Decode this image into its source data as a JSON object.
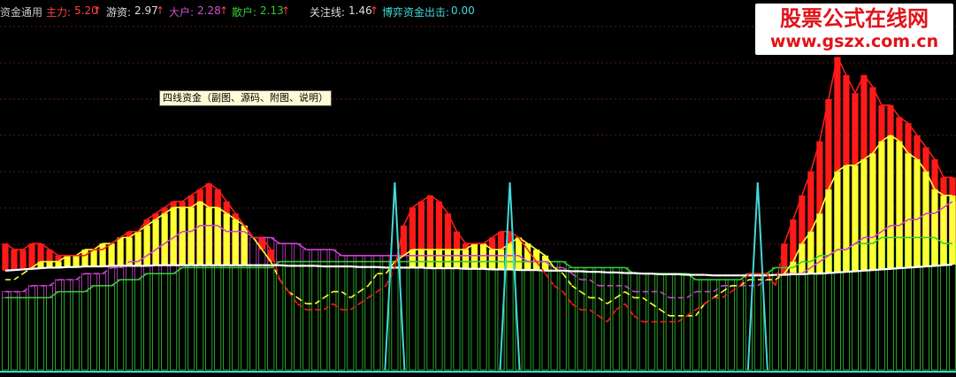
{
  "legend": {
    "indicator_name": "资金通用",
    "main_label": "主力:",
    "main_value": "5.20",
    "hot_label": "游资:",
    "hot_value": "2.97",
    "big_label": "大户:",
    "big_value": "2.28",
    "retail_label": "散户:",
    "retail_value": "2.13",
    "focus_label": "关注线:",
    "focus_value": "1.46",
    "outflow_label": "博弈资金出击:",
    "outflow_value": "0.00",
    "up_arrow": "↑"
  },
  "annotation": {
    "text": "四线资金（副图、源码、附图、说明）"
  },
  "watermark": {
    "line1": "股票公式在线网",
    "line2": "www.gszx.com.cn"
  },
  "colors": {
    "background": "#000000",
    "main": "#ff1a1a",
    "hot": "#ffff33",
    "big": "#cc44cc",
    "retail": "#33cc33",
    "focus": "#ffffff",
    "outflow": "#44d8d8",
    "grid": "#5a1a1a",
    "legend_text": "#c8c8c8"
  },
  "chart_data": {
    "type": "line",
    "title": "四线资金（副图、源码、附图、说明）",
    "grid": true,
    "x": [
      1,
      2,
      3,
      4,
      5,
      6,
      7,
      8,
      9,
      10,
      11,
      12,
      13,
      14,
      15,
      16,
      17,
      18,
      19,
      20,
      21,
      22,
      23,
      24,
      25,
      26,
      27,
      28,
      29,
      30,
      31,
      32,
      33,
      34,
      35,
      36,
      37,
      38,
      39,
      40,
      41,
      42,
      43,
      44,
      45,
      46,
      47,
      48,
      49,
      50,
      51,
      52,
      53,
      54,
      55,
      56,
      57,
      58,
      59,
      60,
      61,
      62,
      63,
      64,
      65,
      66,
      67,
      68,
      69,
      70,
      71,
      72,
      73,
      74,
      75,
      76,
      77,
      78,
      79,
      80,
      81,
      82,
      83,
      84,
      85,
      86,
      87,
      88,
      89,
      90,
      91,
      92,
      93,
      94,
      95,
      96,
      97,
      98,
      99,
      100,
      101,
      102,
      103,
      104,
      105,
      106,
      107,
      108
    ],
    "ylim": [
      0,
      6
    ],
    "series": [
      {
        "name": "主力",
        "color": "#ff1a1a",
        "style": "solid",
        "values": [
          2.1,
          2.0,
          2.0,
          2.1,
          2.1,
          2.0,
          1.9,
          1.9,
          1.9,
          1.9,
          2.0,
          2.0,
          2.1,
          2.2,
          2.3,
          2.3,
          2.5,
          2.6,
          2.7,
          2.8,
          2.8,
          2.9,
          3.0,
          3.1,
          3.0,
          2.8,
          2.6,
          2.4,
          2.2,
          2.2,
          2.0,
          1.5,
          1.3,
          1.1,
          1.0,
          1.0,
          1.0,
          1.1,
          1.0,
          1.0,
          1.1,
          1.2,
          1.3,
          1.4,
          1.7,
          2.4,
          2.7,
          2.8,
          2.9,
          2.8,
          2.6,
          2.3,
          2.1,
          2.1,
          2.1,
          2.2,
          2.3,
          2.3,
          2.2,
          2.0,
          1.8,
          1.6,
          1.4,
          1.3,
          1.1,
          1.0,
          1.0,
          0.9,
          0.8,
          1.0,
          1.1,
          0.9,
          0.8,
          0.8,
          0.8,
          0.8,
          0.8,
          0.9,
          1.0,
          1.1,
          1.2,
          1.2,
          1.3,
          1.4,
          1.6,
          1.6,
          1.6,
          1.4,
          2.1,
          2.5,
          2.9,
          3.3,
          3.8,
          4.5,
          5.2,
          4.9,
          4.6,
          4.9,
          4.7,
          4.4,
          4.4,
          4.2,
          4.1,
          3.9,
          3.7,
          3.5,
          3.2,
          3.2
        ]
      },
      {
        "name": "游资",
        "color": "#ffff33",
        "style": "solid",
        "values": [
          1.5,
          1.5,
          1.6,
          1.7,
          1.8,
          1.8,
          1.8,
          1.9,
          1.9,
          2.0,
          2.0,
          2.1,
          2.1,
          2.2,
          2.2,
          2.3,
          2.4,
          2.5,
          2.6,
          2.7,
          2.7,
          2.7,
          2.8,
          2.7,
          2.7,
          2.6,
          2.5,
          2.4,
          2.2,
          2.0,
          1.8,
          1.5,
          1.3,
          1.2,
          1.1,
          1.1,
          1.2,
          1.3,
          1.3,
          1.2,
          1.3,
          1.4,
          1.6,
          1.6,
          1.8,
          1.9,
          2.0,
          2.0,
          2.0,
          2.0,
          2.0,
          2.0,
          2.0,
          2.1,
          2.1,
          2.0,
          2.0,
          2.1,
          2.2,
          2.1,
          2.0,
          1.9,
          1.7,
          1.6,
          1.4,
          1.3,
          1.2,
          1.2,
          1.1,
          1.2,
          1.3,
          1.2,
          1.2,
          1.1,
          1.0,
          0.9,
          0.9,
          0.9,
          0.9,
          1.1,
          1.2,
          1.3,
          1.4,
          1.4,
          1.5,
          1.5,
          1.5,
          1.5,
          1.6,
          1.8,
          2.1,
          2.3,
          2.6,
          3.0,
          3.3,
          3.4,
          3.4,
          3.5,
          3.6,
          3.8,
          3.9,
          3.8,
          3.6,
          3.5,
          3.3,
          3.0,
          2.9,
          2.9
        ]
      },
      {
        "name": "大户",
        "color": "#cc44cc",
        "style": "solid",
        "values": [
          1.3,
          1.3,
          1.3,
          1.4,
          1.4,
          1.4,
          1.5,
          1.5,
          1.5,
          1.6,
          1.6,
          1.6,
          1.7,
          1.7,
          1.8,
          1.8,
          1.9,
          2.0,
          2.1,
          2.2,
          2.3,
          2.3,
          2.4,
          2.4,
          2.4,
          2.3,
          2.3,
          2.3,
          2.2,
          2.2,
          2.2,
          2.1,
          2.1,
          2.1,
          2.0,
          2.0,
          2.0,
          2.0,
          1.9,
          1.9,
          1.9,
          1.9,
          1.9,
          1.9,
          1.9,
          1.9,
          1.9,
          1.9,
          1.9,
          1.9,
          1.9,
          1.9,
          1.9,
          1.9,
          1.9,
          1.9,
          1.9,
          1.9,
          1.9,
          1.8,
          1.8,
          1.8,
          1.7,
          1.7,
          1.6,
          1.5,
          1.5,
          1.4,
          1.4,
          1.4,
          1.4,
          1.3,
          1.3,
          1.3,
          1.3,
          1.2,
          1.2,
          1.2,
          1.3,
          1.3,
          1.3,
          1.4,
          1.4,
          1.4,
          1.4,
          1.4,
          1.5,
          1.5,
          1.6,
          1.6,
          1.6,
          1.7,
          1.8,
          1.9,
          2.0,
          2.0,
          2.1,
          2.2,
          2.2,
          2.3,
          2.4,
          2.4,
          2.5,
          2.5,
          2.6,
          2.6,
          2.7,
          2.8
        ]
      },
      {
        "name": "散户",
        "color": "#33cc33",
        "style": "solid",
        "values": [
          1.2,
          1.2,
          1.2,
          1.2,
          1.2,
          1.2,
          1.3,
          1.3,
          1.3,
          1.3,
          1.4,
          1.4,
          1.4,
          1.5,
          1.5,
          1.5,
          1.6,
          1.6,
          1.6,
          1.6,
          1.7,
          1.7,
          1.7,
          1.7,
          1.7,
          1.7,
          1.7,
          1.7,
          1.7,
          1.7,
          1.7,
          1.8,
          1.8,
          1.8,
          1.8,
          1.8,
          1.8,
          1.8,
          1.8,
          1.8,
          1.8,
          1.8,
          1.8,
          1.8,
          1.8,
          1.8,
          1.8,
          1.8,
          1.8,
          1.8,
          1.8,
          1.8,
          1.8,
          1.8,
          1.8,
          1.8,
          1.8,
          1.8,
          1.8,
          1.8,
          1.8,
          1.8,
          1.8,
          1.8,
          1.7,
          1.7,
          1.7,
          1.7,
          1.7,
          1.7,
          1.7,
          1.6,
          1.6,
          1.6,
          1.6,
          1.6,
          1.6,
          1.6,
          1.5,
          1.5,
          1.5,
          1.5,
          1.5,
          1.5,
          1.6,
          1.6,
          1.6,
          1.7,
          1.7,
          1.7,
          1.8,
          1.8,
          1.9,
          1.9,
          2.0,
          2.0,
          2.1,
          2.1,
          2.1,
          2.2,
          2.2,
          2.2,
          2.2,
          2.2,
          2.2,
          2.2,
          2.1,
          2.1
        ]
      },
      {
        "name": "关注线",
        "color": "#ffffff",
        "style": "solid",
        "values": [
          1.65,
          1.66,
          1.67,
          1.68,
          1.69,
          1.7,
          1.7,
          1.71,
          1.71,
          1.72,
          1.72,
          1.72,
          1.73,
          1.73,
          1.73,
          1.73,
          1.73,
          1.74,
          1.74,
          1.74,
          1.74,
          1.74,
          1.74,
          1.74,
          1.74,
          1.74,
          1.74,
          1.74,
          1.74,
          1.74,
          1.74,
          1.74,
          1.73,
          1.73,
          1.73,
          1.73,
          1.72,
          1.72,
          1.72,
          1.72,
          1.71,
          1.71,
          1.71,
          1.7,
          1.7,
          1.7,
          1.7,
          1.7,
          1.69,
          1.69,
          1.69,
          1.69,
          1.68,
          1.68,
          1.68,
          1.67,
          1.67,
          1.67,
          1.66,
          1.66,
          1.66,
          1.65,
          1.65,
          1.65,
          1.64,
          1.64,
          1.63,
          1.63,
          1.62,
          1.62,
          1.61,
          1.61,
          1.6,
          1.6,
          1.59,
          1.59,
          1.59,
          1.58,
          1.58,
          1.58,
          1.57,
          1.57,
          1.57,
          1.57,
          1.57,
          1.57,
          1.57,
          1.58,
          1.58,
          1.59,
          1.59,
          1.6,
          1.6,
          1.61,
          1.62,
          1.63,
          1.64,
          1.65,
          1.66,
          1.67,
          1.68,
          1.69,
          1.7,
          1.71,
          1.72,
          1.73,
          1.74,
          1.75
        ]
      },
      {
        "name": "博弈资金出击",
        "color": "#44d8d8",
        "style": "solid",
        "values": [
          0,
          0,
          0,
          0,
          0,
          0,
          0,
          0,
          0,
          0,
          0,
          0,
          0,
          0,
          0,
          0,
          0,
          0,
          0,
          0,
          0,
          0,
          0,
          0,
          0,
          0,
          0,
          0,
          0,
          0,
          0,
          0,
          0,
          0,
          0,
          0,
          0,
          0,
          0,
          0,
          0,
          0,
          0,
          0,
          3.0,
          0,
          0,
          0,
          0,
          0,
          0,
          0,
          0,
          0,
          0,
          0,
          0,
          3.0,
          0,
          0,
          0,
          0,
          0,
          0,
          0,
          0,
          0,
          0,
          0,
          0,
          0,
          0,
          0,
          0,
          0,
          0,
          0,
          0,
          0,
          0,
          0,
          0,
          0,
          0,
          0,
          3.0,
          0,
          0,
          0,
          0,
          0,
          0,
          0,
          0,
          0,
          0,
          0,
          0,
          0,
          0,
          0,
          0,
          0,
          0,
          0,
          0,
          0,
          0
        ]
      }
    ]
  }
}
